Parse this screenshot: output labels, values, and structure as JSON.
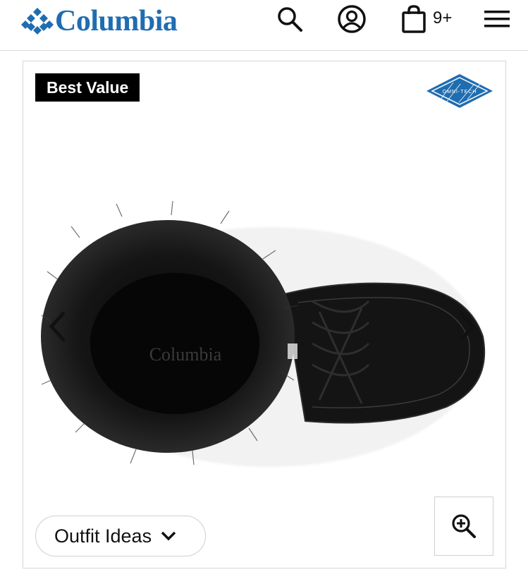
{
  "header": {
    "brand": "Columbia",
    "cart_count": "9+",
    "icons": [
      "columbia-diamond-logo",
      "search-icon",
      "account-icon",
      "shopping-bag-icon",
      "hamburger-menu-icon"
    ],
    "brand_color": "#1f6db1"
  },
  "gallery": {
    "badge": "Best Value",
    "technology_badge": "OMNI-TECH",
    "technology_badge_color": "#1f6db1",
    "product_imprint": "Columbia",
    "outfit_button": "Outfit Ideas",
    "icons": [
      "chevron-left-icon",
      "chevron-right-icon",
      "chevron-down-icon",
      "zoom-in-icon"
    ]
  }
}
